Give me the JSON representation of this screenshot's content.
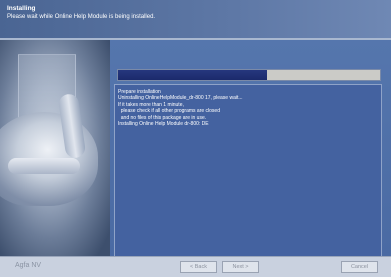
{
  "header": {
    "title": "Installing",
    "subtitle": "Please wait while Online Help Module is being installed."
  },
  "progress": {
    "fraction": 0.57
  },
  "log": {
    "lines": [
      "Prepare installation",
      "Uninstalling OnlineHelpModule_dr-800 17, please wait...",
      "If it takes more than 1 minute,",
      "  please check if all other programs are closed",
      "  and no files of this package are in use.",
      "Installing Online Help Module dr-800: DE"
    ]
  },
  "footer": {
    "brand": "Agfa NV",
    "back_label": "< Back",
    "next_label": "Next >",
    "cancel_label": "Cancel"
  }
}
